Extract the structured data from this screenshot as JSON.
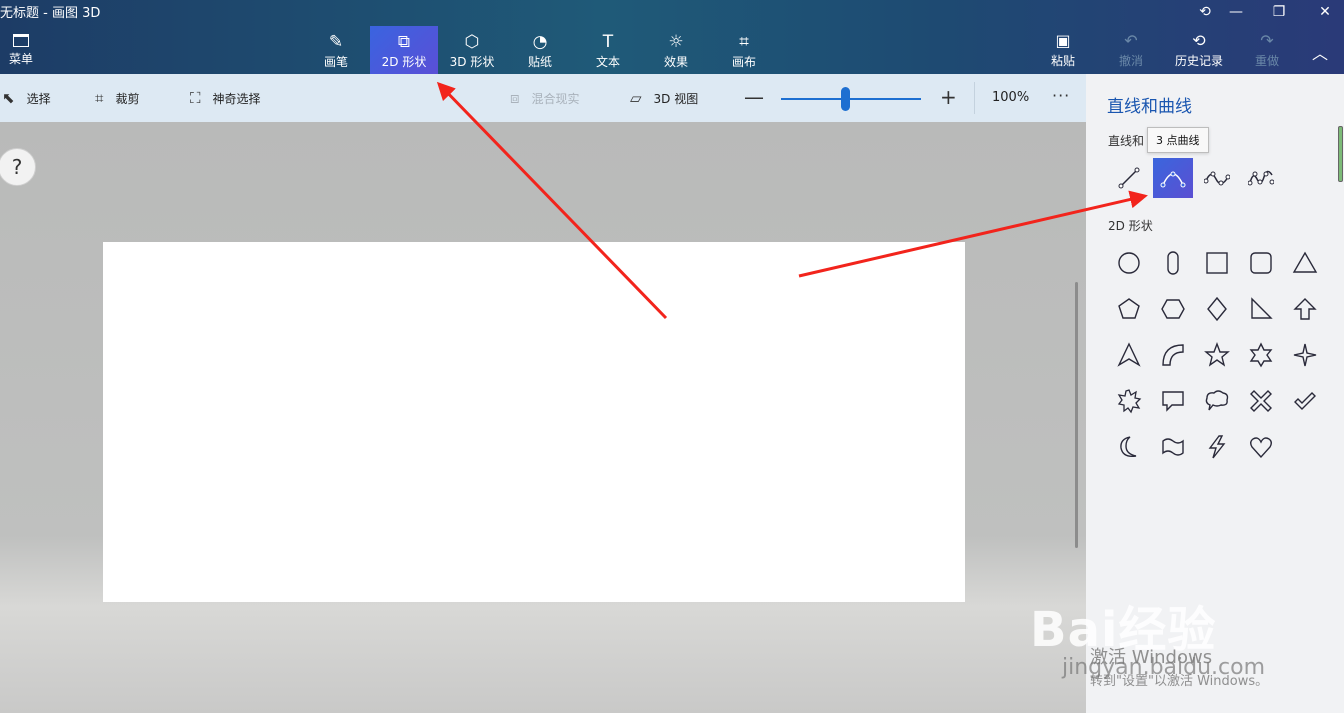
{
  "app": {
    "title": "无标题 - 画图 3D"
  },
  "window_controls": {
    "history_icon": "history-icon",
    "minimize": "—",
    "restore": "❐",
    "close": "✕"
  },
  "menu": {
    "label": "菜单"
  },
  "tools": [
    {
      "label": "画笔",
      "glyph": "✎"
    },
    {
      "label": "2D 形状",
      "glyph": "⧉"
    },
    {
      "label": "3D 形状",
      "glyph": "⬡"
    },
    {
      "label": "贴纸",
      "glyph": "◔"
    },
    {
      "label": "文本",
      "glyph": "T"
    },
    {
      "label": "效果",
      "glyph": "☼"
    },
    {
      "label": "画布",
      "glyph": "⌗"
    }
  ],
  "right_tools": [
    {
      "label": "粘贴",
      "glyph": "📋"
    },
    {
      "label": "撤消",
      "glyph": "↶"
    },
    {
      "label": "历史记录",
      "glyph": "⟲"
    },
    {
      "label": "重做",
      "glyph": "↷"
    }
  ],
  "collapse_glyph": "︿",
  "subbar": {
    "select": "选择",
    "crop": "裁剪",
    "magic_select": "神奇选择",
    "mixed_reality": "混合现实",
    "view_3d": "3D 视图",
    "zoom_minus": "—",
    "zoom_plus": "+",
    "zoom_percent": "100%",
    "more": "···",
    "zoom_level": 0.46
  },
  "help": {
    "label": "?"
  },
  "panel": {
    "title": "直线和曲线",
    "section_lines": "直线和",
    "tooltip": "3 点曲线",
    "section_2d": "2D 形状"
  },
  "watermark": {
    "logo": "Bai经验",
    "line1": "激活 Windows",
    "line2": "jingyan.baidu.com",
    "line3": "转到\"设置\"以激活 Windows。"
  },
  "colors": {
    "accent": "#3a64e0",
    "panel_title": "#1a56b0",
    "arrow": "#f2241c"
  }
}
